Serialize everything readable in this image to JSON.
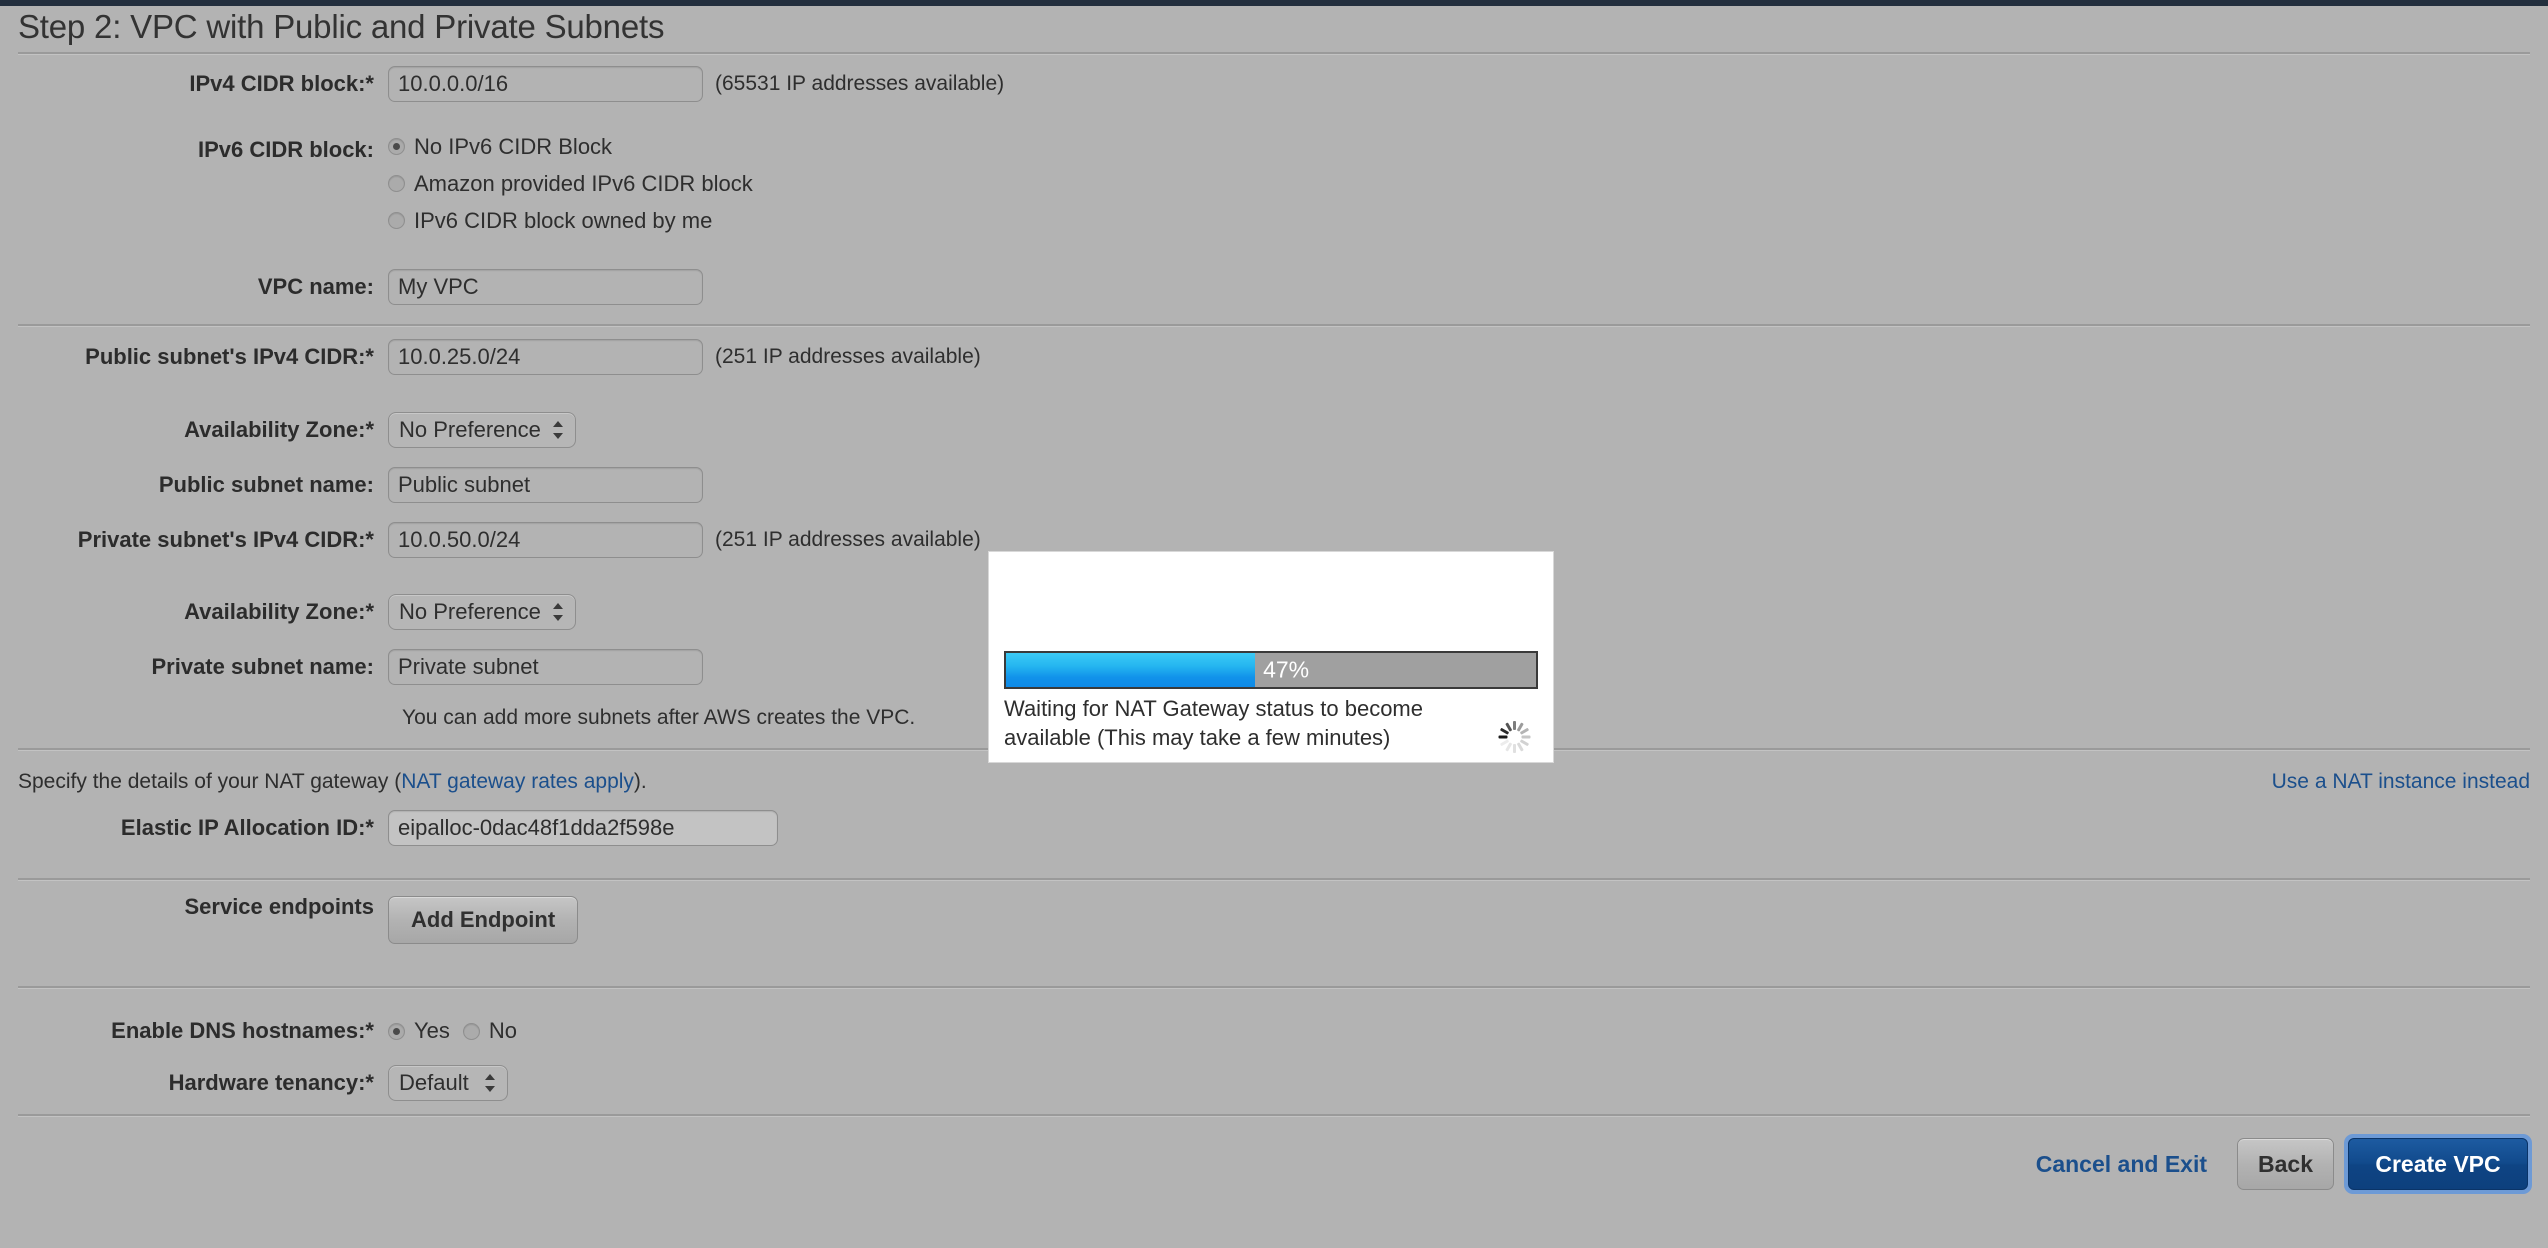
{
  "page": {
    "step_title": "Step 2: VPC with Public and Private Subnets"
  },
  "form": {
    "ipv4_cidr": {
      "label": "IPv4 CIDR block:*",
      "value": "10.0.0.0/16",
      "hint": "(65531 IP addresses available)"
    },
    "ipv6_cidr": {
      "label": "IPv6 CIDR block:",
      "options": [
        {
          "label": "No IPv6 CIDR Block",
          "checked": true
        },
        {
          "label": "Amazon provided IPv6 CIDR block",
          "checked": false
        },
        {
          "label": "IPv6 CIDR block owned by me",
          "checked": false
        }
      ]
    },
    "vpc_name": {
      "label": "VPC name:",
      "value": "My VPC"
    },
    "public_subnet_cidr": {
      "label": "Public subnet's IPv4 CIDR:*",
      "value": "10.0.25.0/24",
      "hint": "(251 IP addresses available)"
    },
    "public_az": {
      "label": "Availability Zone:*",
      "value": "No Preference"
    },
    "public_subnet_name": {
      "label": "Public subnet name:",
      "value": "Public subnet"
    },
    "private_subnet_cidr": {
      "label": "Private subnet's IPv4 CIDR:*",
      "value": "10.0.50.0/24",
      "hint": "(251 IP addresses available)"
    },
    "private_az": {
      "label": "Availability Zone:*",
      "value": "No Preference"
    },
    "private_subnet_name": {
      "label": "Private subnet name:",
      "value": "Private subnet"
    },
    "subnets_note": "You can add more subnets after AWS creates the VPC."
  },
  "nat": {
    "description_prefix": "Specify the details of your NAT gateway (",
    "rates_link": "NAT gateway rates apply",
    "description_suffix": ").",
    "use_instance_link": "Use a NAT instance instead",
    "eip_label": "Elastic IP Allocation ID:*",
    "eip_value": "eipalloc-0dac48f1dda2f598e"
  },
  "endpoints": {
    "label": "Service endpoints",
    "add_button": "Add Endpoint"
  },
  "dns": {
    "label": "Enable DNS hostnames:*",
    "options": [
      {
        "label": "Yes",
        "checked": true
      },
      {
        "label": "No",
        "checked": false
      }
    ]
  },
  "tenancy": {
    "label": "Hardware tenancy:*",
    "value": "Default"
  },
  "footer": {
    "cancel_label": "Cancel and Exit",
    "back_label": "Back",
    "create_label": "Create VPC"
  },
  "modal": {
    "progress_percent": 47,
    "progress_label": "47%",
    "message": "Waiting for NAT Gateway status to become available (This may take a few minutes)"
  },
  "colors": {
    "page_bg": "#b3b3b3",
    "link": "#1b4f8c",
    "primary_button": "#0e4484",
    "progress_fill": "#25b6f0",
    "top_chrome": "#232f3e"
  }
}
